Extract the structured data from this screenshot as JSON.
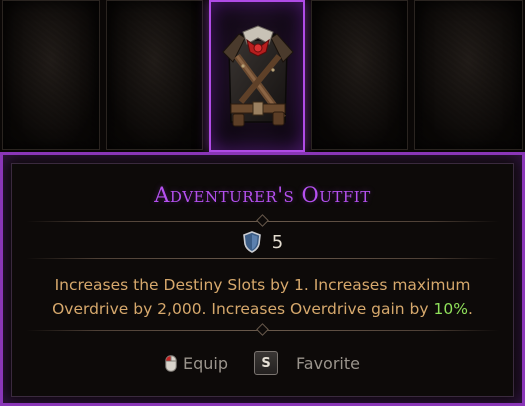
{
  "inventory": {
    "slots": [
      {
        "item": ""
      },
      {
        "item": ""
      },
      {
        "item": "outfit",
        "selected": true
      },
      {
        "item": ""
      },
      {
        "item": ""
      }
    ]
  },
  "tooltip": {
    "title": "Adventurer's Outfit",
    "rarity_icon": "shield-icon",
    "rarity_value": "5",
    "description_parts": {
      "main": "Increases the Destiny Slots by 1. Increases maximum Overdrive by 2,000. Increases Overdrive gain by ",
      "highlight": "10%",
      "end": "."
    },
    "controls": {
      "equip_label": "Equip",
      "favorite_key": "S",
      "favorite_label": "Favorite"
    }
  },
  "colors": {
    "title": "#b550f0",
    "frame": "#8a36b8",
    "description": "#d6a86c",
    "highlight": "#8fe05a",
    "control_label": "#9a948c"
  }
}
